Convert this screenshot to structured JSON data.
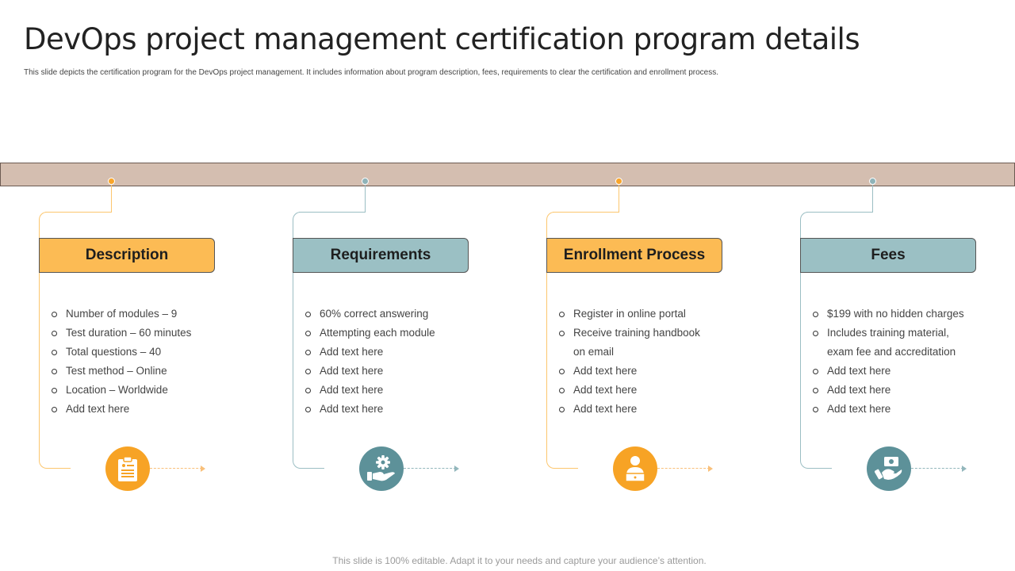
{
  "slide": {
    "title": "DevOps project management certification program details",
    "subtitle": "This slide depicts the certification program for the DevOps project management.  It includes information about program description, fees, requirements to clear the certification and enrollment process.",
    "footer": "This slide is 100% editable. Adapt it to your needs and capture your audience’s attention."
  },
  "colors": {
    "band": "#d4beb0",
    "orange_header": "#fcbb54",
    "teal_header": "#9bc0c4",
    "orange_icon": "#f7a325",
    "teal_icon": "#5d9199"
  },
  "columns": [
    {
      "header": "Description",
      "theme": "orange",
      "icon": "clipboard-document-icon",
      "items": [
        "Number of modules – 9",
        "Test duration – 60 minutes",
        "Total questions – 40",
        "Test method – Online",
        "Location – Worldwide",
        "Add text here"
      ]
    },
    {
      "header": "Requirements",
      "theme": "teal",
      "icon": "gear-in-hand-icon",
      "items": [
        "60% correct answering",
        "Attempting each module",
        "Add text here",
        "Add text here",
        "Add text here",
        "Add text here"
      ]
    },
    {
      "header": "Enrollment Process",
      "theme": "orange",
      "icon": "user-at-laptop-icon",
      "items": [
        "Register in online portal",
        "Receive training handbook on email",
        "Add text here",
        "Add text here",
        "Add text here"
      ]
    },
    {
      "header": "Fees",
      "theme": "teal",
      "icon": "money-in-hand-icon",
      "items": [
        "$199 with no hidden charges",
        "Includes training material, exam fee and accreditation",
        "Add text here",
        "Add text here",
        "Add text here"
      ]
    }
  ]
}
